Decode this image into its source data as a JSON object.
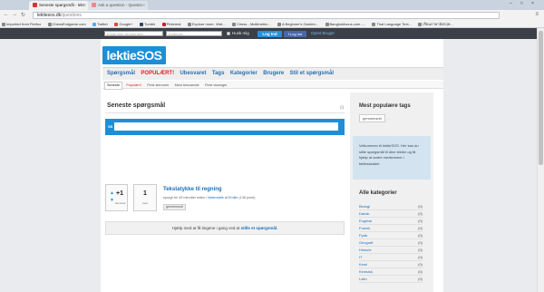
{
  "browser": {
    "tabs": [
      {
        "title": "Seneste spørgsmål - lekt",
        "active": true
      },
      {
        "title": "Ask a question - Questio",
        "active": false
      }
    ],
    "url_domain": "lektiesos.dk",
    "url_path": "/questions",
    "bookmarks": [
      "Imported from Firefox",
      "ChessEndgame.com",
      "Twitter",
      "Google+",
      "Tumblr",
      "Pinterest",
      "Explore more. Visit...",
      "Chess - Multimetric...",
      "A Beginner's Garden...",
      "Bangkokfocus.com -...",
      "Thai Language Text...",
      "เรียนภาษาอังกฤษ..."
    ]
  },
  "topbar": {
    "email_placeholder": "Email eller brugernavn",
    "password_placeholder": "Kodeord",
    "remember_label": "Husk mig",
    "login_label": "Log Ind",
    "facebook_label": "Log ind",
    "signup_label": "Opret Bruger"
  },
  "logo": {
    "text_main": "lektie",
    "text_sos": "SOS"
  },
  "nav": {
    "items": [
      "Spørgsmål",
      "POPULÆRT!",
      "Ubesvaret",
      "Tags",
      "Kategorier",
      "Brugere",
      "Stil et spørgsmål"
    ]
  },
  "subnav": {
    "tabs": [
      "Seneste",
      "Populært!",
      "Flest stemmer",
      "Mest besvarede",
      "Flest visninger"
    ]
  },
  "main": {
    "heading": "Seneste spørgsmål",
    "rss_icon": "rss-icon",
    "search_label": "SS",
    "question": {
      "votes": "+1",
      "votes_label": "stemmer",
      "answers": "1",
      "answers_label": "svar",
      "title": "Tekstatykke til regning",
      "meta_prefix": "spurgt for 49 minutter siden i",
      "meta_category": "Matematik",
      "meta_by": "af",
      "meta_user": "Emilie",
      "meta_points": "(136 point)",
      "tag": "gennemsnit"
    },
    "help_text": "Hjælp med at få tingene i gang ved at",
    "help_link": "stille et spørgsmål."
  },
  "sidebar": {
    "popular_title": "Mest populære tags",
    "popular_tag": "gennemsnit",
    "welcome": "Velkommen til lektieSOS. Her kan du stille spørgsmål til dine lektier og få hjælp af andre medlemmer i fællesskabet",
    "categories_title": "Alle kategorier",
    "categories": [
      {
        "name": "Biologi",
        "count": "(0)"
      },
      {
        "name": "Dansk",
        "count": "(0)"
      },
      {
        "name": "Engelsk",
        "count": "(0)"
      },
      {
        "name": "Fransk",
        "count": "(0)"
      },
      {
        "name": "Fysik",
        "count": "(0)"
      },
      {
        "name": "Geografi",
        "count": "(0)"
      },
      {
        "name": "Historie",
        "count": "(0)"
      },
      {
        "name": "IT",
        "count": "(0)"
      },
      {
        "name": "Kemi",
        "count": "(0)"
      },
      {
        "name": "Kinesisk",
        "count": "(0)"
      },
      {
        "name": "Latin",
        "count": "(0)"
      }
    ]
  }
}
